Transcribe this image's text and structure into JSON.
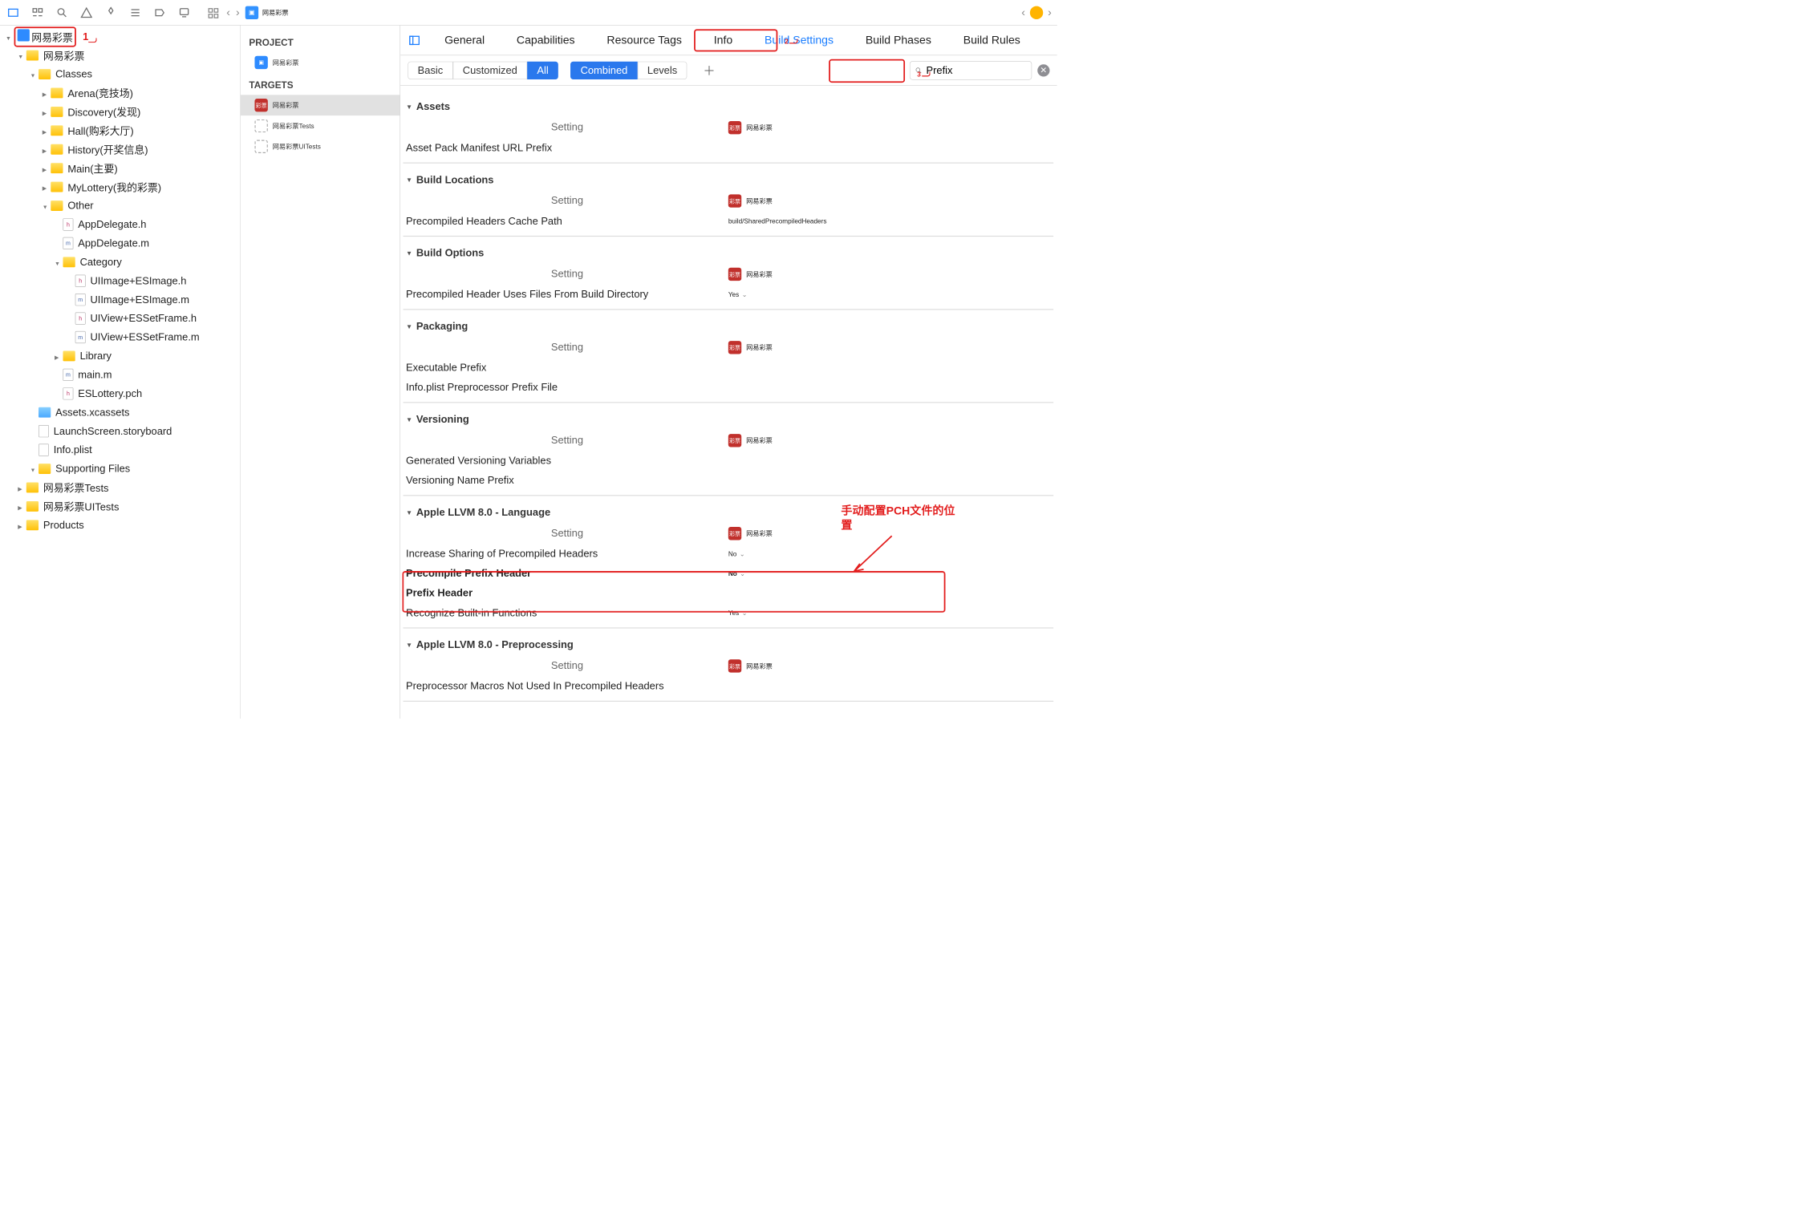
{
  "crumb_title": "网易彩票",
  "nav": [
    {
      "indent": 0,
      "disc": "open",
      "icon": "proj",
      "label": "网易彩票",
      "red_box": true,
      "num": "1"
    },
    {
      "indent": 1,
      "disc": "open",
      "icon": "folder",
      "label": "网易彩票"
    },
    {
      "indent": 2,
      "disc": "open",
      "icon": "folder",
      "label": "Classes"
    },
    {
      "indent": 3,
      "disc": "closed",
      "icon": "folder",
      "label": "Arena(竞技场)"
    },
    {
      "indent": 3,
      "disc": "closed",
      "icon": "folder",
      "label": "Discovery(发现)"
    },
    {
      "indent": 3,
      "disc": "closed",
      "icon": "folder",
      "label": "Hall(购彩大厅)"
    },
    {
      "indent": 3,
      "disc": "closed",
      "icon": "folder",
      "label": "History(开奖信息)"
    },
    {
      "indent": 3,
      "disc": "closed",
      "icon": "folder",
      "label": "Main(主要)"
    },
    {
      "indent": 3,
      "disc": "closed",
      "icon": "folder",
      "label": "MyLottery(我的彩票)"
    },
    {
      "indent": 3,
      "disc": "open",
      "icon": "folder",
      "label": "Other"
    },
    {
      "indent": 4,
      "disc": "none",
      "icon": "h",
      "label": "AppDelegate.h"
    },
    {
      "indent": 4,
      "disc": "none",
      "icon": "m",
      "label": "AppDelegate.m"
    },
    {
      "indent": 4,
      "disc": "open",
      "icon": "folder",
      "label": "Category"
    },
    {
      "indent": 5,
      "disc": "none",
      "icon": "h",
      "label": "UIImage+ESImage.h"
    },
    {
      "indent": 5,
      "disc": "none",
      "icon": "m",
      "label": "UIImage+ESImage.m"
    },
    {
      "indent": 5,
      "disc": "none",
      "icon": "h",
      "label": "UIView+ESSetFrame.h"
    },
    {
      "indent": 5,
      "disc": "none",
      "icon": "m",
      "label": "UIView+ESSetFrame.m"
    },
    {
      "indent": 4,
      "disc": "closed",
      "icon": "folder",
      "label": "Library"
    },
    {
      "indent": 4,
      "disc": "none",
      "icon": "m",
      "label": "main.m"
    },
    {
      "indent": 4,
      "disc": "none",
      "icon": "h",
      "label": "ESLottery.pch"
    },
    {
      "indent": 2,
      "disc": "none",
      "icon": "group",
      "label": "Assets.xcassets"
    },
    {
      "indent": 2,
      "disc": "none",
      "icon": "plist",
      "label": "LaunchScreen.storyboard"
    },
    {
      "indent": 2,
      "disc": "none",
      "icon": "plist",
      "label": "Info.plist"
    },
    {
      "indent": 2,
      "disc": "open",
      "icon": "folder",
      "label": "Supporting Files"
    },
    {
      "indent": 1,
      "disc": "closed",
      "icon": "folder",
      "label": "网易彩票Tests"
    },
    {
      "indent": 1,
      "disc": "closed",
      "icon": "folder",
      "label": "网易彩票UITests"
    },
    {
      "indent": 1,
      "disc": "closed",
      "icon": "folder",
      "label": "Products"
    }
  ],
  "ptcol": {
    "proj_header": "PROJECT",
    "targets_header": "TARGETS",
    "project": "网易彩票",
    "targets": [
      {
        "label": "网易彩票",
        "kind": "app",
        "sel": true
      },
      {
        "label": "网易彩票Tests",
        "kind": "tool"
      },
      {
        "label": "网易彩票UITests",
        "kind": "tool"
      }
    ]
  },
  "tabs": [
    "General",
    "Capabilities",
    "Resource Tags",
    "Info",
    "Build Settings",
    "Build Phases",
    "Build Rules"
  ],
  "active_tab": "Build Settings",
  "filter": {
    "basic": "Basic",
    "customized": "Customized",
    "all": "All",
    "combined": "Combined",
    "levels": "Levels"
  },
  "search_value": "Prefix",
  "target_name": "网易彩票",
  "sections": [
    {
      "title": "Assets",
      "rows": [
        {
          "label": "Asset Pack Manifest URL Prefix",
          "value": ""
        }
      ]
    },
    {
      "title": "Build Locations",
      "rows": [
        {
          "label": "Precompiled Headers Cache Path",
          "value": "build/SharedPrecompiledHeaders"
        }
      ]
    },
    {
      "title": "Build Options",
      "rows": [
        {
          "label": "Precompiled Header Uses Files From Build Directory",
          "value": "Yes",
          "popup": true
        }
      ]
    },
    {
      "title": "Packaging",
      "rows": [
        {
          "label": "Executable Prefix",
          "value": ""
        },
        {
          "label": "Info.plist Preprocessor Prefix File",
          "value": ""
        }
      ]
    },
    {
      "title": "Versioning",
      "rows": [
        {
          "label": "Generated Versioning Variables",
          "value": ""
        },
        {
          "label": "Versioning Name Prefix",
          "value": ""
        }
      ]
    },
    {
      "title": "Apple LLVM 8.0 - Language",
      "rows": [
        {
          "label": "Increase Sharing of Precompiled Headers",
          "value": "No",
          "popup": true
        },
        {
          "label": "Precompile Prefix Header",
          "value": "No",
          "popup": true,
          "bold": true
        },
        {
          "label": "Prefix Header",
          "value": "",
          "bold": true
        },
        {
          "label": "Recognize Built-in Functions",
          "value": "Yes",
          "popup": true
        }
      ]
    },
    {
      "title": "Apple LLVM 8.0 - Preprocessing",
      "rows": [
        {
          "label": "Preprocessor Macros Not Used In Precompiled Headers",
          "value": ""
        }
      ]
    }
  ],
  "setting_col_label": "Setting",
  "annot_num2": "2",
  "annot_num3": "3",
  "annot_text": "手动配置PCH文件的位置"
}
